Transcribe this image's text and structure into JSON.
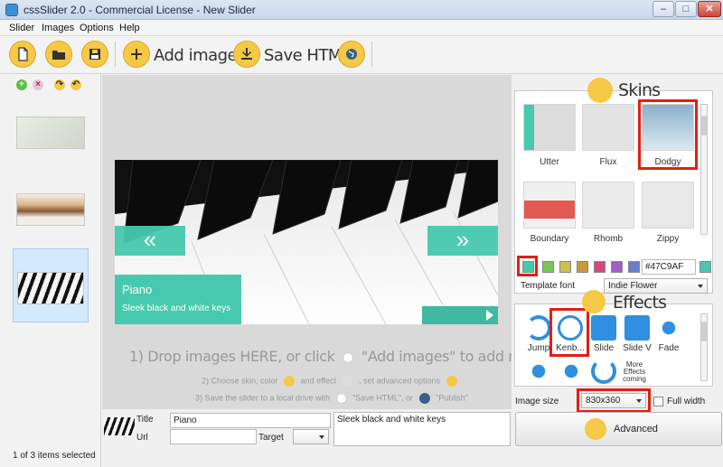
{
  "window": {
    "title": "cssSlider 2.0 - Commercial License - New Slider",
    "min": "–",
    "max": "□",
    "close": "✕"
  },
  "menu": [
    "Slider",
    "Images",
    "Options",
    "Help"
  ],
  "toolbar": {
    "add_images": "Add images",
    "save_html": "Save HTML"
  },
  "status": "1 of 3 items selected",
  "stage": {
    "caption_title": "Piano",
    "caption_sub": "Sleek black and white keys",
    "prev": "«",
    "next": "»",
    "drop_line1a": "1) Drop images HERE, or click",
    "drop_line1b": "\"Add images\" to add more slides",
    "drop_line2a": "2) Choose skin, color",
    "drop_line2b": "and effect",
    "drop_line2c": ", set advanced options",
    "drop_line3a": "3) Save the slider to a local drive with",
    "drop_line3b": "\"Save HTML\", or",
    "drop_line3c": "\"Publish\""
  },
  "props": {
    "title_label": "Title",
    "title_value": "Piano",
    "url_label": "Url",
    "url_value": "",
    "target_label": "Target",
    "description": "Sleek black and white keys"
  },
  "skins": {
    "title": "Skins",
    "items": [
      "Utter",
      "Flux",
      "Dodgy",
      "Boundary",
      "Rhomb",
      "Zippy"
    ],
    "color_value": "#47C9AF",
    "swatches": [
      "#47c9af",
      "#7ac74f",
      "#c9c24e",
      "#c99a3d",
      "#d24a7a",
      "#a45ec4",
      "#6a7bd0"
    ],
    "font_label": "Template font",
    "font_value": "Indie Flower"
  },
  "effects": {
    "title": "Effects",
    "items": [
      "Jump",
      "Kenb...",
      "Slide",
      "Slide V",
      "Fade"
    ],
    "more": "More\nEffects\ncoming",
    "size_label": "Image size",
    "size_value": "830x360",
    "full_width": "Full width",
    "advanced": "Advanced"
  },
  "colors": {
    "accent": "#47c9af",
    "highlight": "#e02010",
    "toolbar_icon": "#f5c946"
  }
}
